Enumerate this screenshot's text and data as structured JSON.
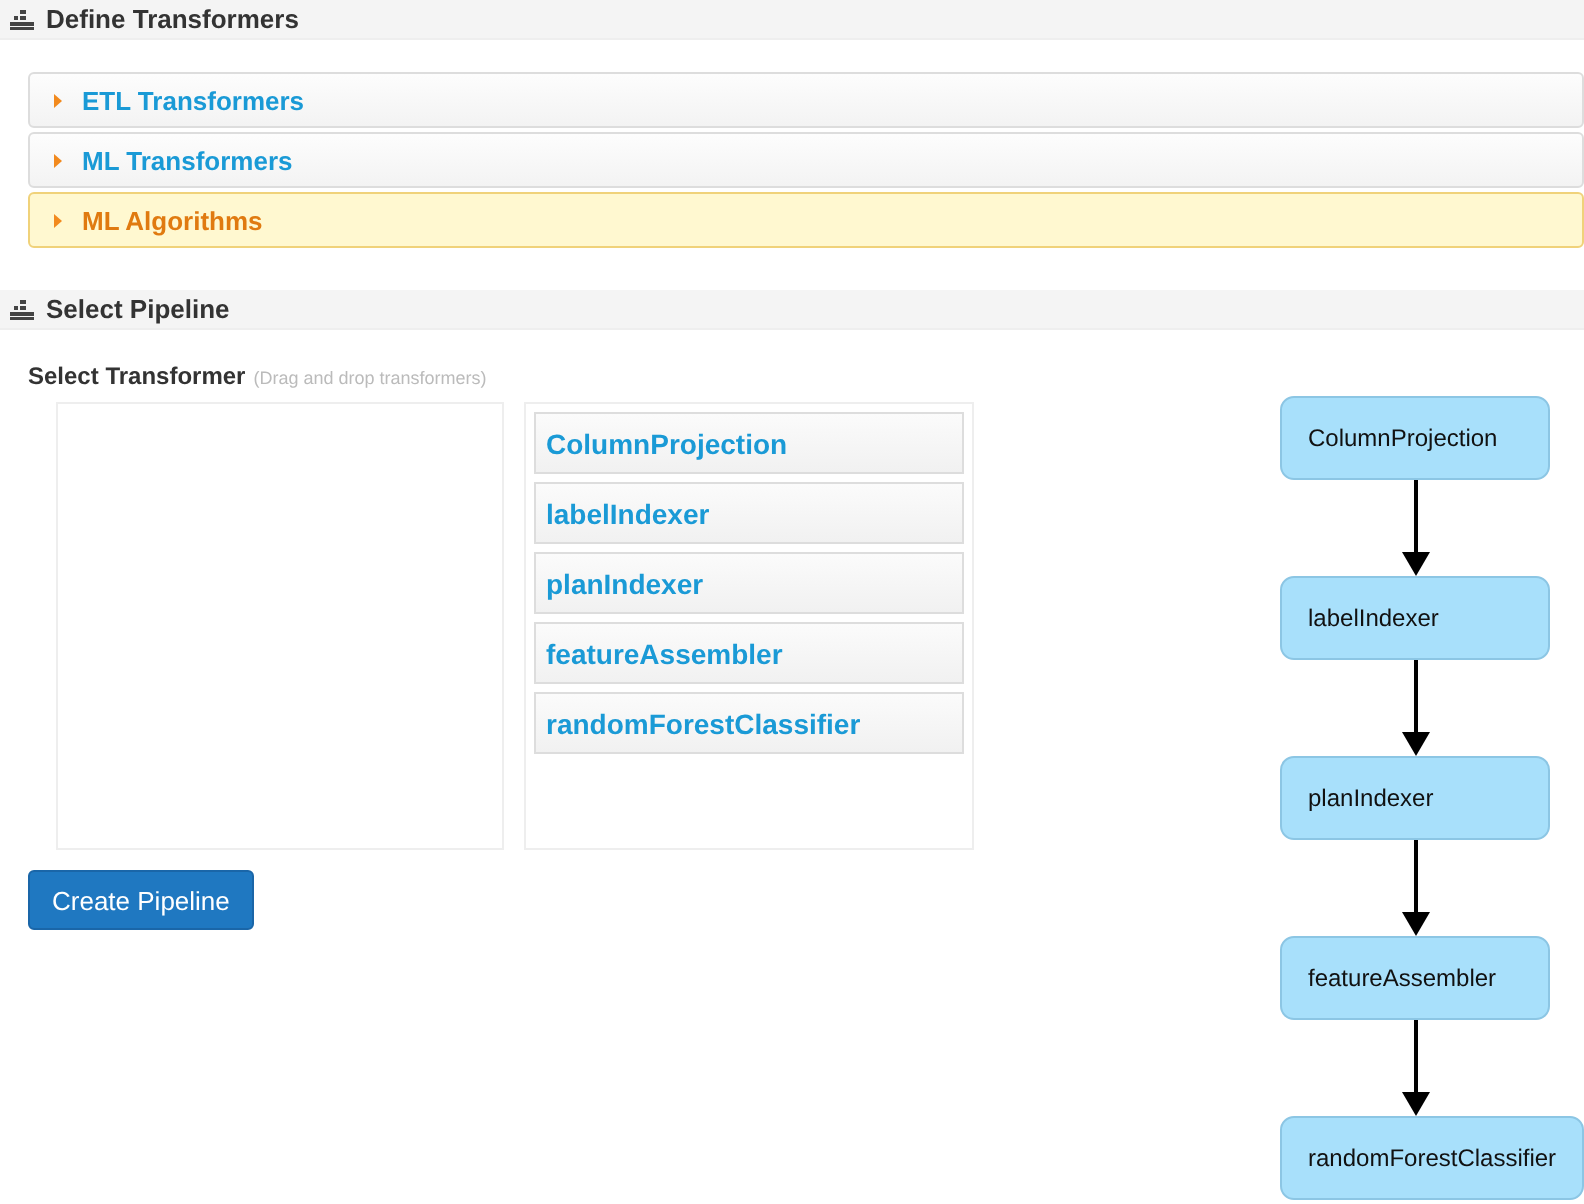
{
  "define_section": {
    "title": "Define Transformers"
  },
  "accordion": [
    {
      "label": "ETL Transformers",
      "selected": false
    },
    {
      "label": "ML Transformers",
      "selected": false
    },
    {
      "label": "ML Algorithms",
      "selected": true
    }
  ],
  "pipeline_section": {
    "title": "Select Pipeline"
  },
  "select_transformer": {
    "label": "Select Transformer",
    "hint": "(Drag and drop transformers)"
  },
  "transformer_list": [
    "ColumnProjection",
    "labelIndexer",
    "planIndexer",
    "featureAssembler",
    "randomForestClassifier"
  ],
  "create_button": "Create Pipeline",
  "pipeline_diagram": [
    "ColumnProjection",
    "labelIndexer",
    "planIndexer",
    "featureAssembler",
    "randomForestClassifier"
  ]
}
